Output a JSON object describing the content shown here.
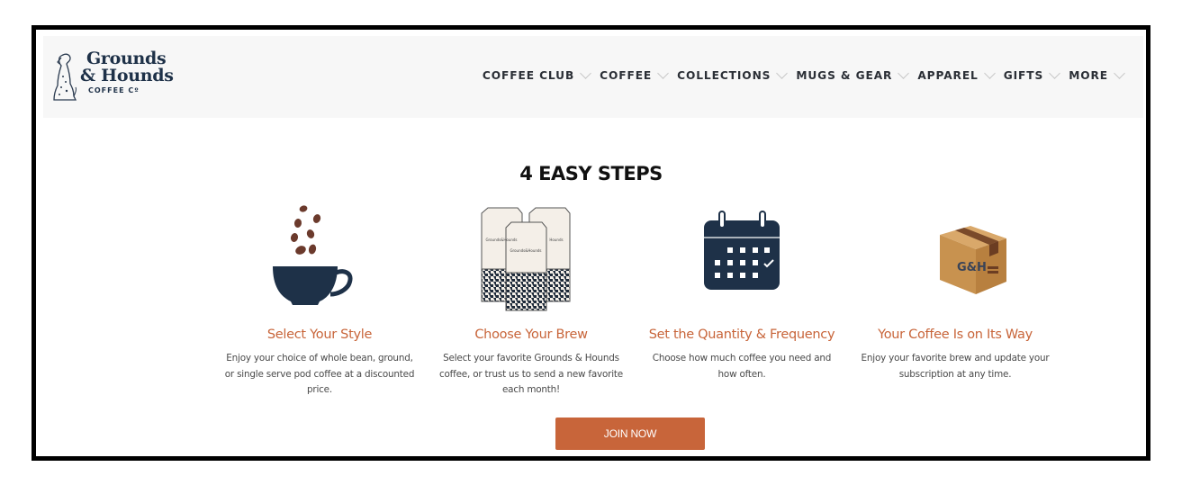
{
  "brand": {
    "line1": "Grounds",
    "line2": "& Hounds",
    "line3": "COFFEE Cº"
  },
  "nav": {
    "items": [
      {
        "label": "COFFEE CLUB",
        "icon": "chevron-down-icon"
      },
      {
        "label": "COFFEE",
        "icon": "chevron-down-icon"
      },
      {
        "label": "COLLECTIONS",
        "icon": "chevron-down-icon"
      },
      {
        "label": "MUGS & GEAR",
        "icon": "chevron-down-icon"
      },
      {
        "label": "APPAREL",
        "icon": "chevron-down-icon"
      },
      {
        "label": "GIFTS",
        "icon": "chevron-down-icon"
      },
      {
        "label": "MORE",
        "icon": "chevron-down-icon"
      }
    ]
  },
  "section": {
    "title": "4 EASY STEPS",
    "steps": [
      {
        "icon": "coffee-cup-beans-icon",
        "heading": "Select Your Style",
        "description": "Enjoy your choice of whole bean, ground, or single serve pod coffee at a discounted price."
      },
      {
        "icon": "coffee-bags-icon",
        "heading": "Choose Your Brew",
        "description": "Select your favorite Grounds & Hounds coffee, or trust us to send a new favorite each month!"
      },
      {
        "icon": "calendar-icon",
        "heading": "Set the Quantity & Frequency",
        "description": "Choose how much coffee you need and how often."
      },
      {
        "icon": "shipping-box-icon",
        "heading": "Your Coffee Is on Its Way",
        "description": "Enjoy your favorite brew and update your subscription at any time."
      }
    ],
    "box_label": "G&H",
    "cta_label": "JOIN NOW"
  },
  "colors": {
    "accent": "#c8653a",
    "navy": "#1e3148",
    "header_bg": "#f7f7f7"
  }
}
